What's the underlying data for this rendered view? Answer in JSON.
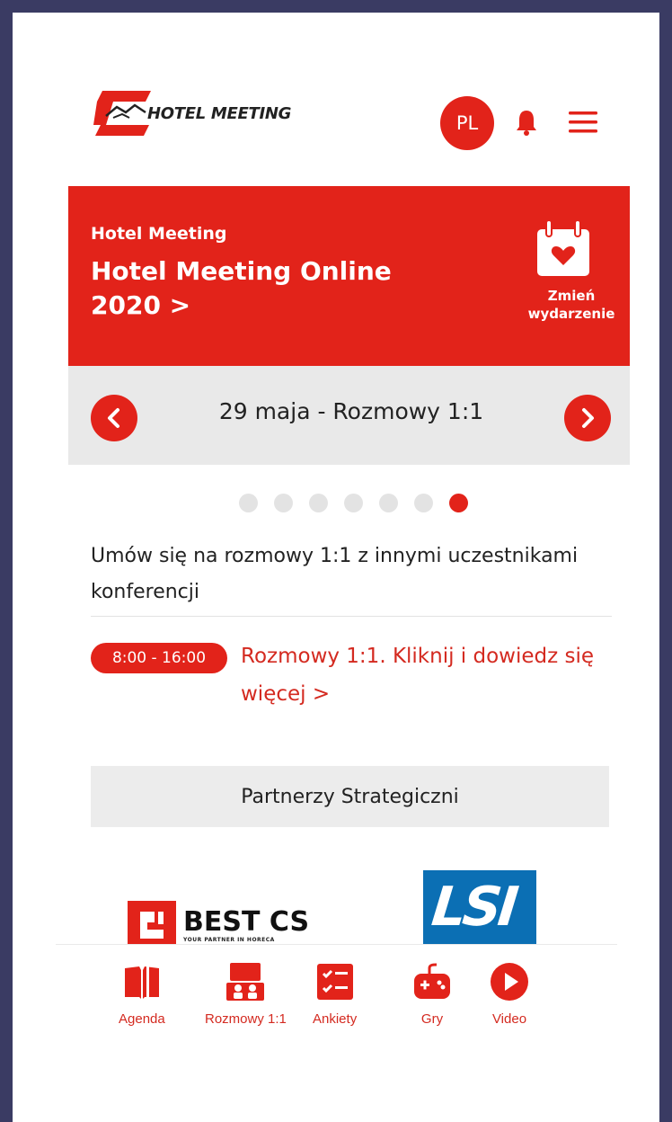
{
  "header": {
    "logo_text": "HOTEL MEETING",
    "language": "PL",
    "icons": [
      "bell-icon",
      "hamburger-menu-icon"
    ]
  },
  "event": {
    "organizer": "Hotel Meeting",
    "title": "Hotel Meeting Online 2020 >",
    "change_label_line1": "Zmień",
    "change_label_line2": "wydarzenie",
    "icon": "calendar-heart-icon"
  },
  "day_switcher": {
    "label": "29 maja - Rozmowy 1:1",
    "prev_icon": "chevron-left-icon",
    "next_icon": "chevron-right-icon"
  },
  "pagination": {
    "total": 7,
    "active_index": 6
  },
  "description": "Umów się na rozmowy 1:1 z innymi uczestnikami konferencji",
  "session": {
    "time": "8:00 - 16:00",
    "link_text": "Rozmowy 1:1. Kliknij i dowiedz się więcej >"
  },
  "partners": {
    "heading": "Partnerzy Strategiczni",
    "logos": [
      {
        "name": "BEST CS",
        "tagline": "YOUR PARTNER IN HORECA"
      },
      {
        "name": "LSI"
      }
    ]
  },
  "bottom_nav": [
    {
      "label": "Agenda",
      "icon": "book-icon"
    },
    {
      "label": "Rozmowy 1:1",
      "icon": "meeting-icon"
    },
    {
      "label": "Ankiety",
      "icon": "checklist-icon"
    },
    {
      "label": "Gry",
      "icon": "gamepad-icon"
    },
    {
      "label": "Video",
      "icon": "play-icon"
    }
  ],
  "colors": {
    "brand_red": "#e2231a",
    "frame": "#3a3b63",
    "panel_gray": "#e9e9e9"
  }
}
